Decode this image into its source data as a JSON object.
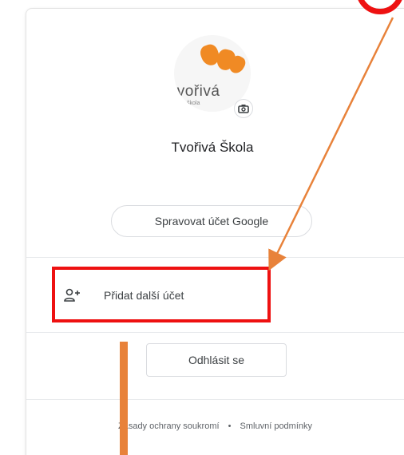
{
  "account": {
    "name": "Tvořivá Škola",
    "avatar_logo_text": "tvořivá",
    "avatar_logo_sub": "škola"
  },
  "buttons": {
    "manage_account": "Spravovat účet Google",
    "add_account": "Přidat další účet",
    "sign_out": "Odhlásit se"
  },
  "footer": {
    "privacy": "Zásady ochrany soukromí",
    "separator": "•",
    "terms": "Smluvní podmínky"
  },
  "icons": {
    "camera": "camera-icon",
    "add_person": "person-add-icon"
  },
  "colors": {
    "annotation_red": "#ee1111",
    "annotation_orange": "#e8823a",
    "logo_orange": "#f08a24"
  }
}
